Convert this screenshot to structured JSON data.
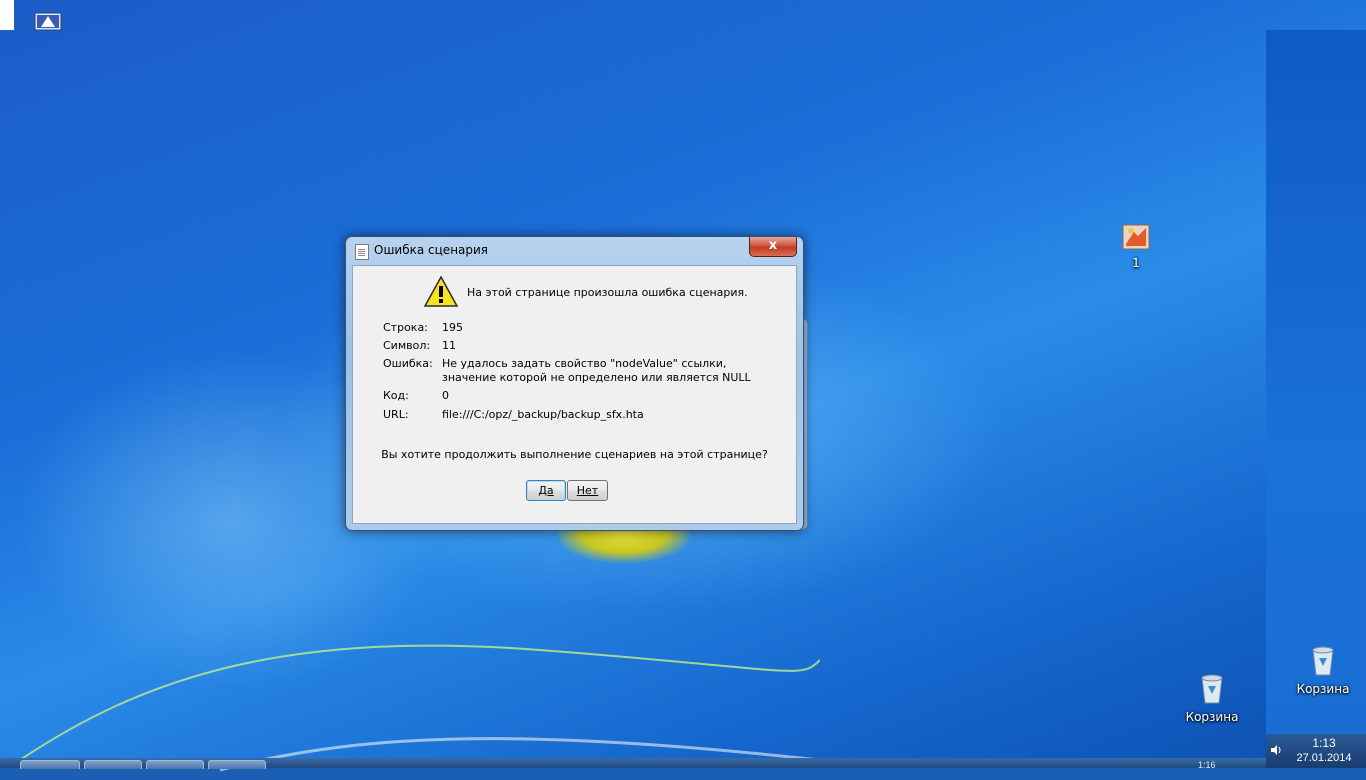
{
  "dialog": {
    "title": "Ошибка сценария",
    "close_label": "x",
    "headline": "На этой странице произошла ошибка сценария.",
    "fields": [
      {
        "key": "Строка:",
        "value": "195"
      },
      {
        "key": "Символ:",
        "value": "11"
      },
      {
        "key": "Ошибка:",
        "value": "Не удалось задать свойство \"nodeValue\" ссылки, значение которой не определено или является NULL"
      },
      {
        "key": "Код:",
        "value": "0"
      },
      {
        "key": "URL:",
        "value": "file:///C:/opz/_backup/backup_sfx.hta"
      }
    ],
    "question": "Вы хотите продолжить выполнение сценариев на этой странице?",
    "yes_label": "Да",
    "no_label": "Нет"
  },
  "desktop": {
    "icons": [
      {
        "label": "1",
        "icon": "paint-app-icon"
      },
      {
        "label": "Корзина",
        "icon": "recycle-bin-icon"
      },
      {
        "label": "Корзина",
        "icon": "recycle-bin-icon"
      }
    ]
  },
  "tray": {
    "time": "1:13",
    "date": "27.01.2014",
    "ghost_time": "1:16"
  },
  "colors": {
    "desktop_blue": "#1a5fb4",
    "close_red": "#c23b22",
    "dialog_client": "#f0f0f0"
  }
}
